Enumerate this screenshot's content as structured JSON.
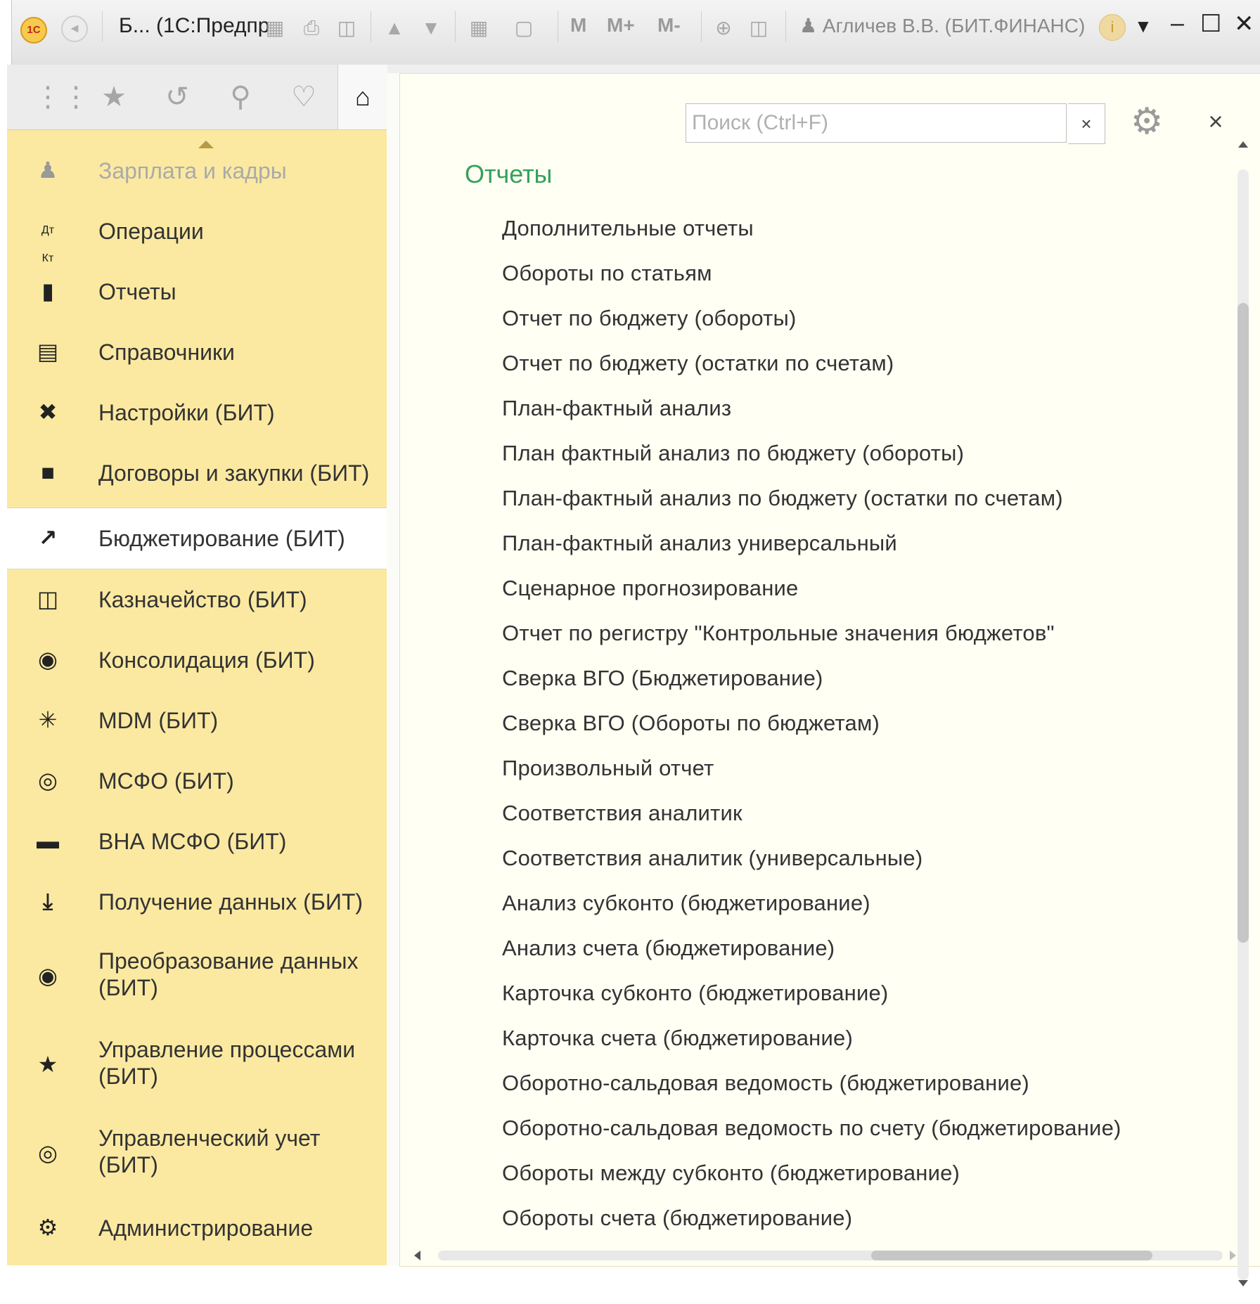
{
  "titlebar": {
    "logo": "1С",
    "title": "Б... (1С:Предпр",
    "memory_buttons": [
      "M",
      "M+",
      "M-"
    ],
    "user": "Агличев В.В. (БИТ.ФИНАНС)",
    "icons": [
      "save-icon",
      "print-icon",
      "preview-icon",
      "upload-icon",
      "download-icon",
      "calculator-icon",
      "calendar-icon",
      "zoom-icon",
      "panel-icon"
    ]
  },
  "sidebar": {
    "toolbar": [
      "apps-grid-icon",
      "star-icon",
      "history-icon",
      "search-icon",
      "bell-icon",
      "home-icon"
    ],
    "items": [
      {
        "label": "Зарплата и кадры",
        "icon": "person-icon",
        "dim": true
      },
      {
        "label": "Операции",
        "icon": "dt-kt-icon"
      },
      {
        "label": "Отчеты",
        "icon": "bar-chart-icon"
      },
      {
        "label": "Справочники",
        "icon": "books-icon"
      },
      {
        "label": "Настройки (БИТ)",
        "icon": "tools-icon"
      },
      {
        "label": "Договоры и закупки (БИТ)",
        "icon": "folder-icon"
      },
      {
        "label": "Бюджетирование (БИТ)",
        "icon": "growth-chart-icon",
        "active": true
      },
      {
        "label": "Казначейство (БИТ)",
        "icon": "money-icon"
      },
      {
        "label": "Консолидация (БИТ)",
        "icon": "globe-sphere-icon"
      },
      {
        "label": "MDM (БИТ)",
        "icon": "network-icon"
      },
      {
        "label": "МСФО (БИТ)",
        "icon": "globe-icon"
      },
      {
        "label": "ВНА МСФО (БИТ)",
        "icon": "truck-icon"
      },
      {
        "label": "Получение данных (БИТ)",
        "icon": "download-icon"
      },
      {
        "label": "Преобразование данных",
        "label2": "(БИТ)",
        "icon": "transform-icon"
      },
      {
        "label": "Управление процессами",
        "label2": "(БИТ)",
        "icon": "process-icon"
      },
      {
        "label": "Управленческий учет",
        "label2": "(БИТ)",
        "icon": "target-icon"
      },
      {
        "label": "Администрирование",
        "icon": "gear-icon"
      }
    ]
  },
  "main": {
    "search_placeholder": "Поиск (Ctrl+F)",
    "section_title": "Отчеты",
    "reports": [
      "Дополнительные отчеты",
      "Обороты по статьям",
      "Отчет по бюджету (обороты)",
      "Отчет по бюджету (остатки по счетам)",
      "План-фактный анализ",
      "План фактный анализ по бюджету (обороты)",
      "План-фактный анализ по бюджету (остатки по счетам)",
      "План-фактный анализ универсальный",
      "Сценарное прогнозирование",
      "Отчет по регистру \"Контрольные значения бюджетов\"",
      "Сверка ВГО (Бюджетирование)",
      "Сверка ВГО (Обороты по бюджетам)",
      "Произвольный отчет",
      "Соответствия аналитик",
      "Соответствия аналитик (универсальные)",
      "Анализ субконто (бюджетирование)",
      "Анализ счета (бюджетирование)",
      "Карточка субконто (бюджетирование)",
      "Карточка счета (бюджетирование)",
      "Оборотно-сальдовая ведомость (бюджетирование)",
      "Оборотно-сальдовая ведомость по счету (бюджетирование)",
      "Обороты между субконто (бюджетирование)",
      "Обороты счета (бюджетирование)"
    ]
  },
  "colors": {
    "sidebar_bg": "#fbe9a1",
    "section_title": "#36a05a",
    "main_bg": "#fffff4"
  }
}
